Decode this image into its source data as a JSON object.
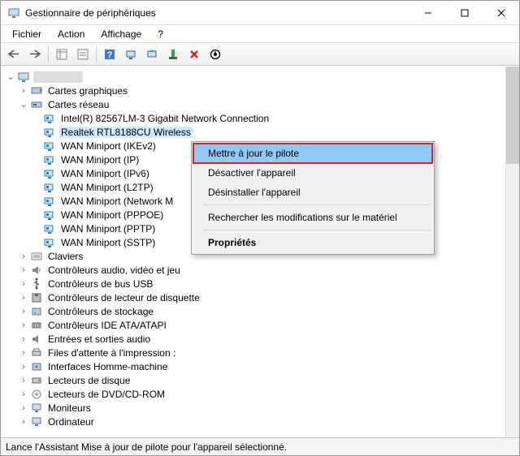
{
  "titlebar": {
    "title": "Gestionnaire de périphériques"
  },
  "menubar": {
    "file": "Fichier",
    "action": "Action",
    "view": "Affichage",
    "help": "?"
  },
  "tree": {
    "root": "",
    "cat_graphics": "Cartes graphiques",
    "cat_network": "Cartes réseau",
    "net_items": [
      "Intel(R) 82567LM-3 Gigabit Network Connection",
      "Realtek RTL8188CU Wireless",
      "WAN Miniport (IKEv2)",
      "WAN Miniport (IP)",
      "WAN Miniport (IPv6)",
      "WAN Miniport (L2TP)",
      "WAN Miniport (Network M",
      "WAN Miniport (PPPOE)",
      "WAN Miniport (PPTP)",
      "WAN Miniport (SSTP)"
    ],
    "cat_keyboards": "Claviers",
    "cat_audio": "Contrôleurs audio, vidéo et jeu",
    "cat_usb": "Contrôleurs de bus USB",
    "cat_floppy": "Contrôleurs de lecteur de disquette",
    "cat_storage": "Contrôleurs de stockage",
    "cat_ide": "Contrôleurs IDE ATA/ATAPI",
    "cat_soundio": "Entrées et sorties audio",
    "cat_printq": "Files d'attente à l'impression :",
    "cat_hid": "Interfaces Homme-machine",
    "cat_disk": "Lecteurs de disque",
    "cat_dvd": "Lecteurs de DVD/CD-ROM",
    "cat_monitors": "Moniteurs",
    "cat_computer": "Ordinateur"
  },
  "context_menu": {
    "update": "Mettre à jour le pilote",
    "disable": "Désactiver l'appareil",
    "uninstall": "Désinstaller l'appareil",
    "scan": "Rechercher les modifications sur le matériel",
    "properties": "Propriétés"
  },
  "statusbar": "Lance l'Assistant Mise à jour de pilote pour l'appareil sélectionné."
}
